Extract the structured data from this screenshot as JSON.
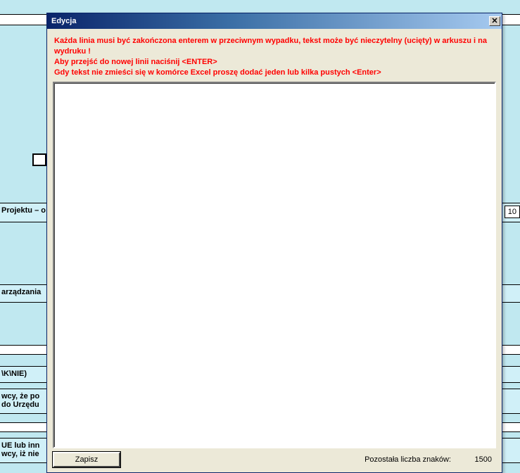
{
  "background": {
    "row1_label": "Projektu – o",
    "row1_right": "10",
    "row2_label": "arządzania",
    "row3_label": "\\K\\NIE)",
    "row4_label_a": "wcy, że po",
    "row4_label_b": "do Urzędu",
    "row5_label_a": "UE lub inn",
    "row5_label_b": "wcy, iż nie"
  },
  "dialog": {
    "title": "Edycja",
    "close_glyph": "✕",
    "instructions_line1": "Każda linia musi być zakończona enterem w przeciwnym wypadku, tekst może być nieczytelny (ucięty) w arkuszu i na wydruku !",
    "instructions_line2": "Aby przejść do nowej linii naciśnij <ENTER>",
    "instructions_line3": "Gdy tekst nie zmieści się w komórce Excel proszę dodać jeden lub kilka pustych <Enter>",
    "textarea_value": "",
    "save_label": "Zapisz",
    "char_label": "Pozostała liczba znaków:",
    "char_count": "1500"
  }
}
